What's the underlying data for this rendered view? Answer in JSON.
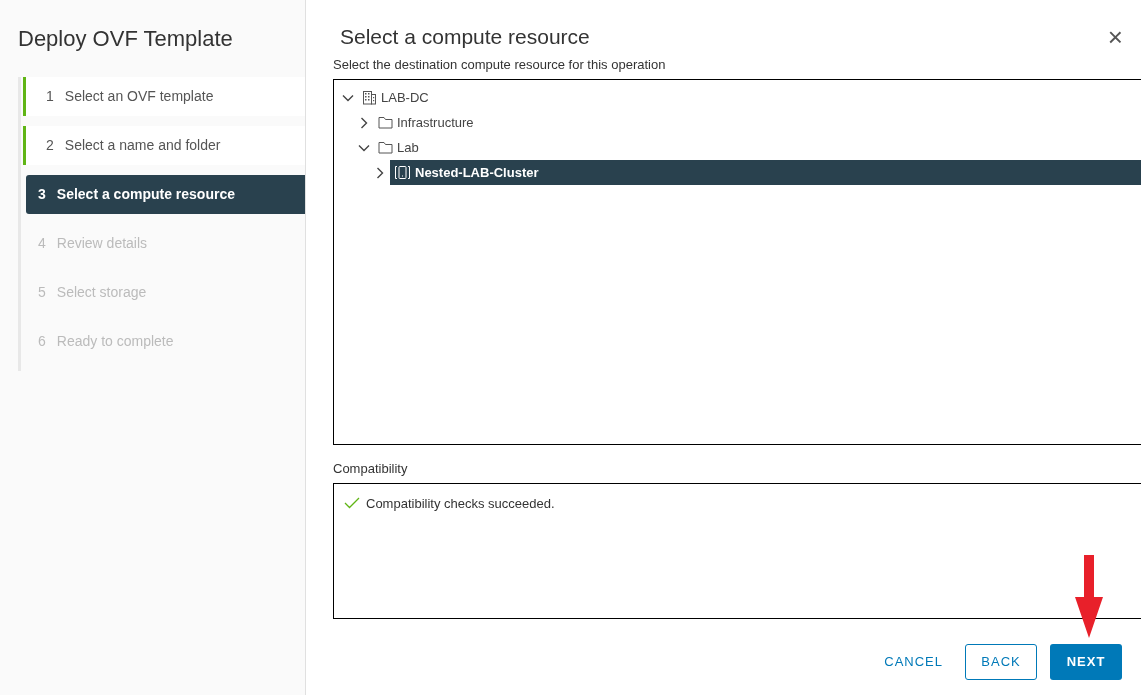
{
  "sidebar": {
    "title": "Deploy OVF Template",
    "steps": [
      {
        "number": "1",
        "label": "Select an OVF template",
        "completed": true,
        "selected": false
      },
      {
        "number": "2",
        "label": "Select a name and folder",
        "completed": true,
        "selected": false
      },
      {
        "number": "3",
        "label": "Select a compute resource",
        "completed": false,
        "selected": true
      },
      {
        "number": "4",
        "label": "Review details",
        "completed": false,
        "selected": false
      },
      {
        "number": "5",
        "label": "Select storage",
        "completed": false,
        "selected": false
      },
      {
        "number": "6",
        "label": "Ready to complete",
        "completed": false,
        "selected": false
      }
    ]
  },
  "dialog": {
    "title": "Select a compute resource",
    "close": "×",
    "instruction": "Select the destination compute resource for this operation",
    "tree": [
      {
        "label": "LAB-DC",
        "kind": "datacenter",
        "expanded": true,
        "selected": false,
        "children": [
          {
            "label": "Infrastructure",
            "kind": "folder",
            "expanded": false,
            "selected": false
          },
          {
            "label": "Lab",
            "kind": "folder",
            "expanded": true,
            "selected": false,
            "children": [
              {
                "label": "Nested-LAB-Cluster",
                "kind": "cluster",
                "expanded": false,
                "selected": true
              }
            ]
          }
        ]
      }
    ],
    "compatibility": {
      "label": "Compatibility",
      "message": "Compatibility checks succeeded.",
      "passed": true
    },
    "buttons": [
      {
        "label": "CANCEL",
        "kind": "link"
      },
      {
        "label": "BACK",
        "kind": "outline"
      },
      {
        "label": "NEXT",
        "kind": "primary"
      }
    ]
  }
}
